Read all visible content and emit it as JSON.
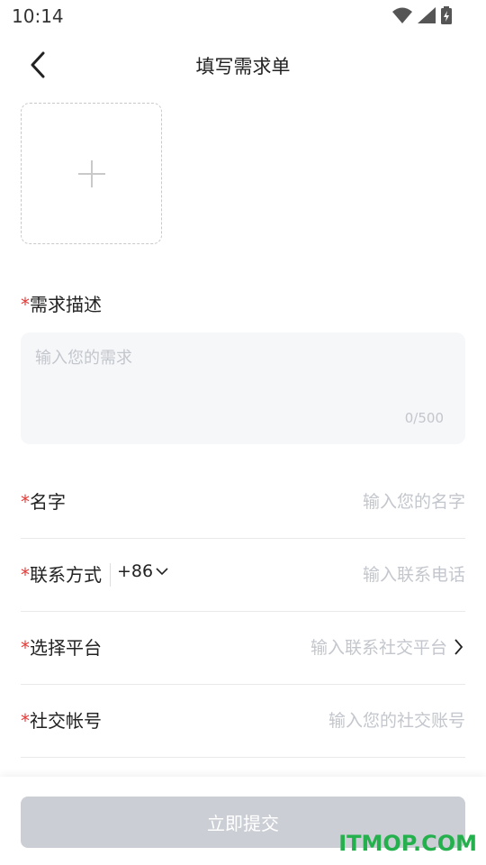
{
  "status_bar": {
    "time": "10:14"
  },
  "nav": {
    "title": "填写需求单"
  },
  "form": {
    "required_mark": "*",
    "description": {
      "label": "需求描述",
      "placeholder": "输入您的需求",
      "counter": "0/500"
    },
    "name": {
      "label": "名字",
      "placeholder": "输入您的名字"
    },
    "contact": {
      "label": "联系方式",
      "country_code": "+86",
      "placeholder": "输入联系电话"
    },
    "platform": {
      "label": "选择平台",
      "placeholder": "输入联系社交平台"
    },
    "account": {
      "label": "社交帐号",
      "placeholder": "输入您的社交账号"
    }
  },
  "submit": {
    "label": "立即提交"
  },
  "watermark": {
    "text": "ITMOP.COM"
  },
  "colors": {
    "required": "#e53935",
    "placeholder": "#c3c6cc",
    "button_disabled": "#cbced4",
    "watermark": "#24b14d"
  }
}
